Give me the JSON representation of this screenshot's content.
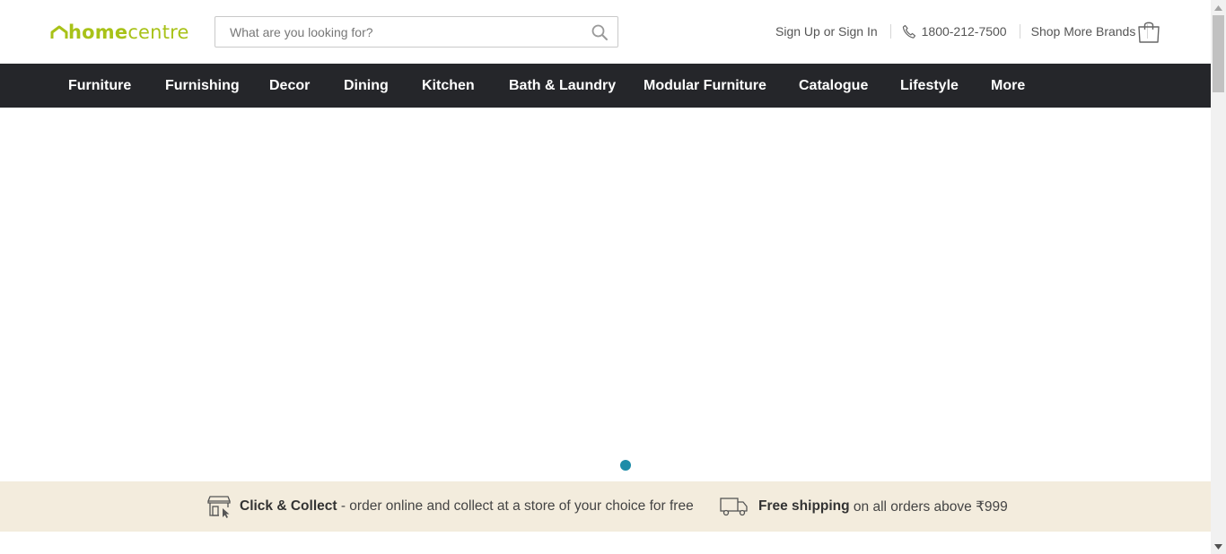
{
  "header": {
    "logo": {
      "part1": "home",
      "part2": "centre",
      "icon": "house-roof-icon",
      "color": "#a8c218"
    },
    "search": {
      "placeholder": "What are you looking for?",
      "value": "",
      "icon": "search-icon"
    },
    "links": {
      "sign_in": "Sign Up or Sign In",
      "phone": "1800-212-7500",
      "phone_icon": "phone-icon",
      "shop_more": "Shop More Brands",
      "cart_icon": "shopping-bag-icon"
    }
  },
  "nav": {
    "background": "#25262a",
    "items": [
      "Furniture",
      "Furnishing",
      "Decor",
      "Dining",
      "Kitchen",
      "Bath & Laundry",
      "Modular Furniture",
      "Catalogue",
      "Lifestyle",
      "More"
    ]
  },
  "hero": {
    "carousel_dot_color": "#1e8ca8"
  },
  "strip": {
    "background": "#f3ecdd",
    "click_collect": {
      "icon": "store-click-icon",
      "title": "Click & Collect",
      "text": " - order online and collect at a store of your choice for free"
    },
    "shipping": {
      "icon": "delivery-truck-icon",
      "title": "Free shipping",
      "text": " on all orders above ₹999"
    }
  }
}
